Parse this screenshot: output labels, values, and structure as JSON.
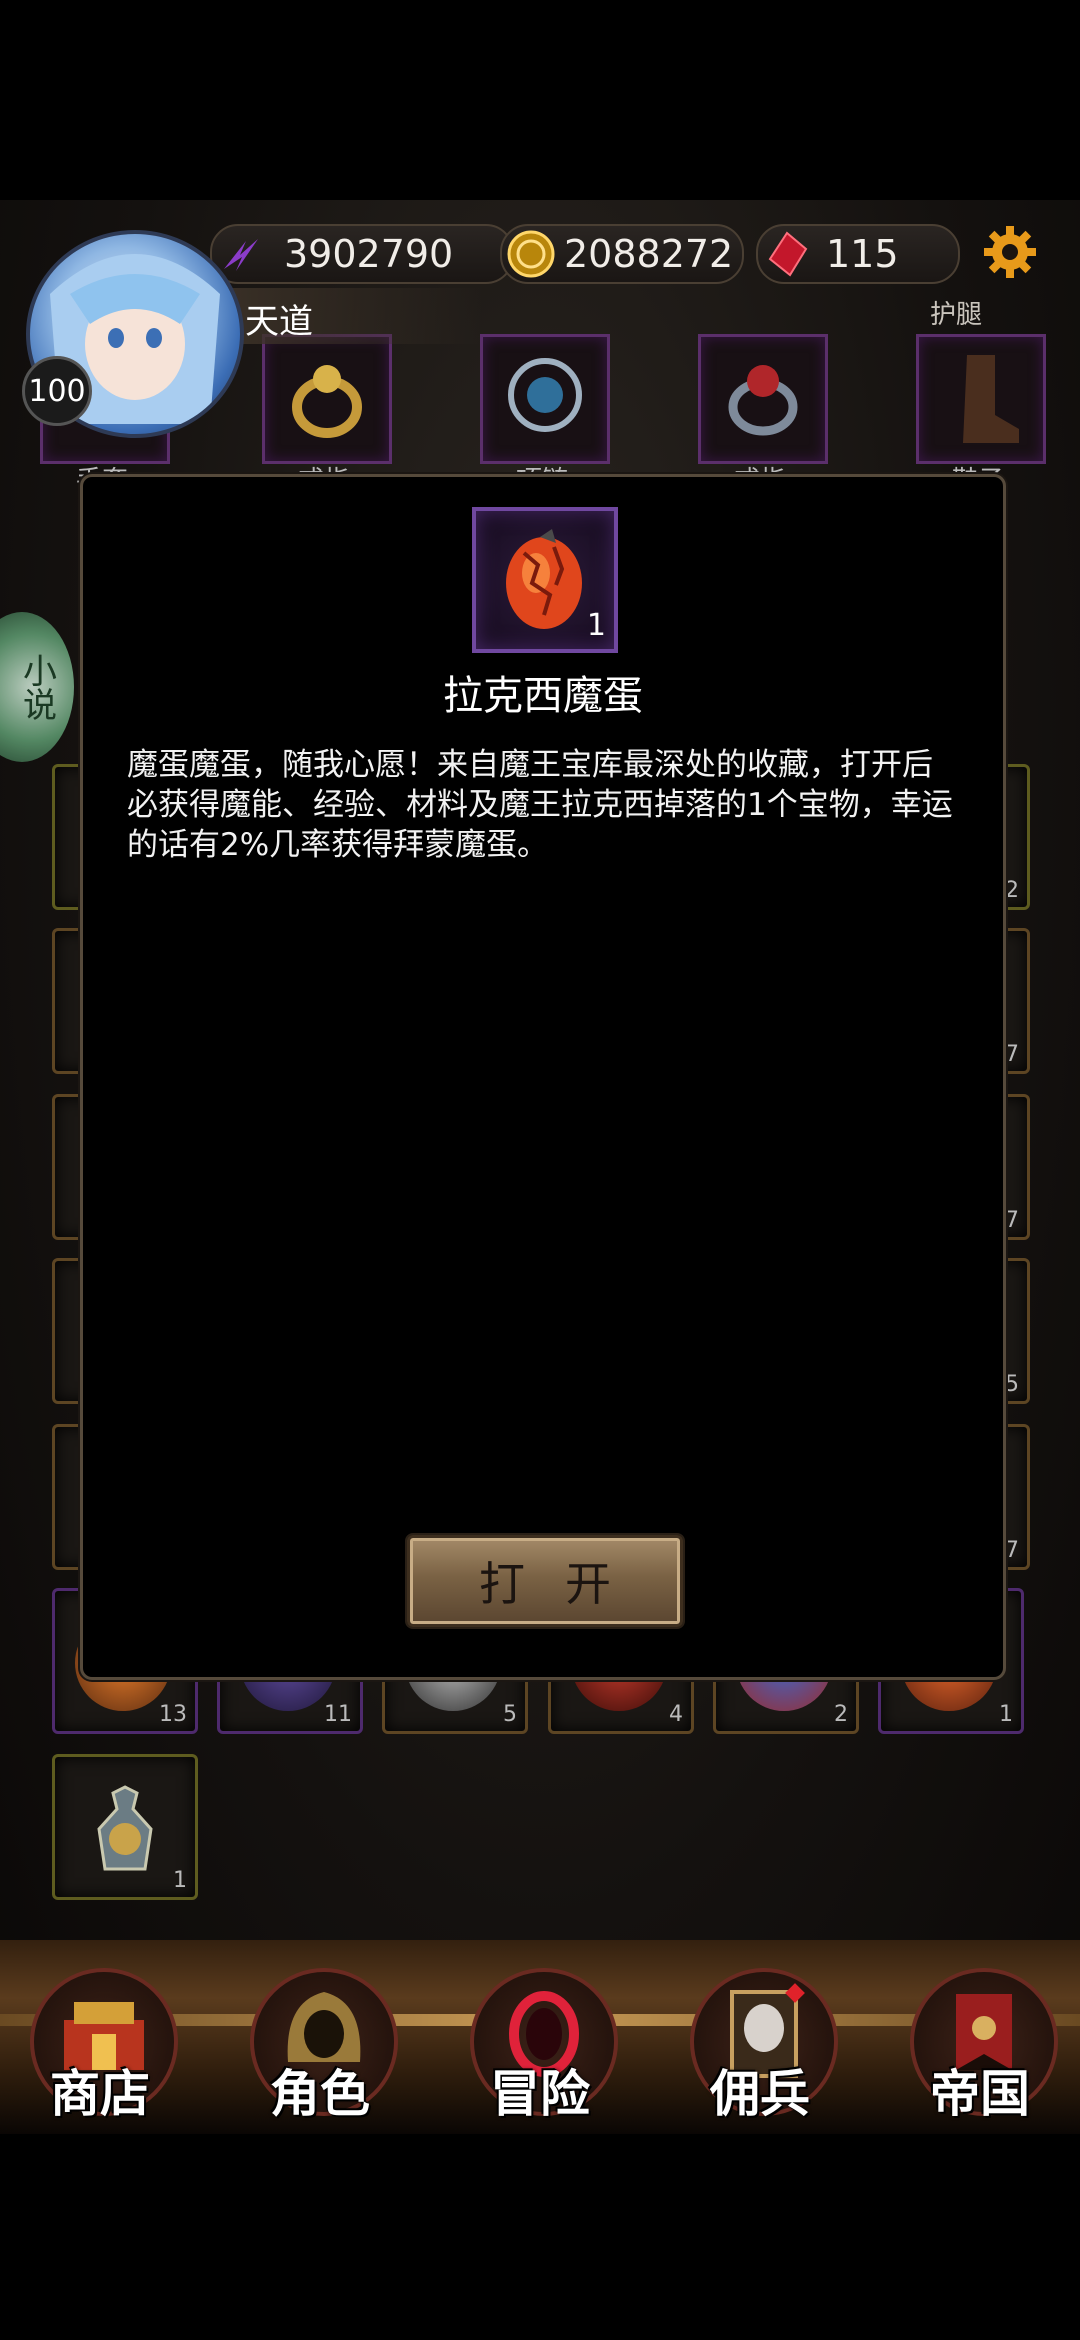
{
  "player": {
    "level": "100",
    "name": "天道"
  },
  "resources": {
    "power": "3902790",
    "gold": "2088272",
    "gems": "115"
  },
  "equipment": {
    "upper_right_label": "护腿",
    "slots": [
      {
        "label": "手套"
      },
      {
        "label": "戒指"
      },
      {
        "label": "项链"
      },
      {
        "label": "戒指"
      },
      {
        "label": "鞋子"
      }
    ]
  },
  "side_badge": {
    "text": "小说"
  },
  "inventory_counts": {
    "right_column": [
      "2",
      "7",
      "7",
      "5",
      "7"
    ],
    "bottom_row": [
      "13",
      "11",
      "5",
      "4",
      "2",
      "1"
    ],
    "last_item": "1"
  },
  "item_modal": {
    "count": "1",
    "name": "拉克西魔蛋",
    "description": "魔蛋魔蛋，随我心愿！来自魔王宝库最深处的收藏，打开后必获得魔能、经验、材料及魔王拉克西掉落的1个宝物，幸运的话有2%几率获得拜蒙魔蛋。",
    "open_label": "打开"
  },
  "nav": [
    {
      "label": "商店",
      "icon": "shop-icon"
    },
    {
      "label": "角色",
      "icon": "hooded-figure-icon"
    },
    {
      "label": "冒险",
      "icon": "portal-icon"
    },
    {
      "label": "佣兵",
      "icon": "mercenary-card-icon"
    },
    {
      "label": "帝国",
      "icon": "banner-icon"
    }
  ],
  "colors": {
    "modal_bg": "#000000",
    "item_frame": "#7048a0",
    "button_gold": "#a48a68"
  }
}
